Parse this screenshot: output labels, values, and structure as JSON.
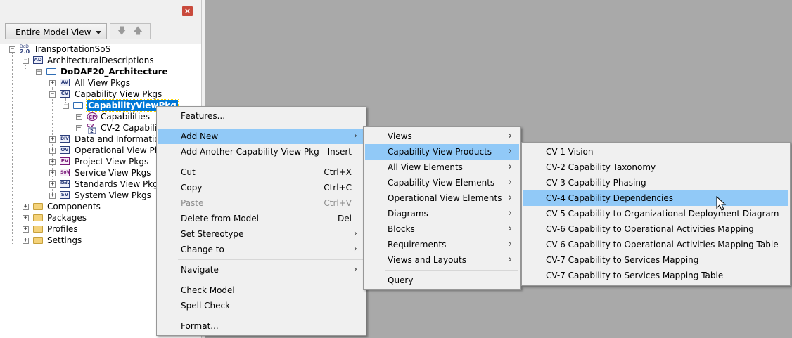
{
  "left_panel": {
    "close_label": "×",
    "view_selector": "Entire Model View",
    "nav_down_icon": "arrow-down-icon",
    "nav_up_icon": "arrow-up-icon"
  },
  "tree": {
    "root": "TransportationSoS",
    "root_badge": "DoD 2.0",
    "architectural_descriptions": "ArchitecturalDescriptions",
    "ad_badge": "AD",
    "architecture": "DoDAF20_Architecture",
    "all_view": "All View Pkgs",
    "capability_view": "Capability View Pkgs",
    "capability_view_pkg": "CapabilityViewPkg",
    "capabilities": "Capabilities",
    "cv2": "CV-2 Capabilit",
    "data_info": "Data and Information",
    "operational": "Operational View Pkgs",
    "project": "Project View Pkgs",
    "service": "Service View Pkgs",
    "standards": "Standards View Pkgs",
    "system": "System View Pkgs",
    "components": "Components",
    "packages": "Packages",
    "profiles": "Profiles",
    "settings": "Settings",
    "badges": {
      "av": "AV",
      "cv": "CV",
      "cp": "CP",
      "cv2": "CV 2",
      "div": "DIV",
      "ov": "OV",
      "pv": "PV",
      "sov": "SoV",
      "stdv": "StdV",
      "sv": "SV"
    }
  },
  "context_menu": {
    "features": "Features...",
    "add_new": "Add New",
    "add_another": "Add Another Capability View Pkg",
    "add_another_shortcut": "Insert",
    "cut": "Cut",
    "cut_shortcut": "Ctrl+X",
    "copy": "Copy",
    "copy_shortcut": "Ctrl+C",
    "paste": "Paste",
    "paste_shortcut": "Ctrl+V",
    "delete": "Delete from Model",
    "delete_shortcut": "Del",
    "set_stereotype": "Set Stereotype",
    "change_to": "Change to",
    "navigate": "Navigate",
    "check_model": "Check Model",
    "spell_check": "Spell Check",
    "format": "Format..."
  },
  "add_new_menu": {
    "views": "Views",
    "capability_view_products": "Capability View Products",
    "all_view_elements": "All View Elements",
    "capability_view_elements": "Capability View Elements",
    "operational_view_elements": "Operational View Elements",
    "diagrams": "Diagrams",
    "blocks": "Blocks",
    "requirements": "Requirements",
    "views_and_layouts": "Views and Layouts",
    "query": "Query"
  },
  "products_menu": {
    "items": [
      "CV-1 Vision",
      "CV-2 Capability Taxonomy",
      "CV-3 Capability Phasing",
      "CV-4 Capability Dependencies",
      "CV-5 Capability to Organizational Deployment Diagram",
      "CV-6 Capability to Operational Activities Mapping",
      "CV-6 Capability to Operational Activities Mapping Table",
      "CV-7 Capability to Services Mapping",
      "CV-7 Capability to Services Mapping Table"
    ]
  },
  "colors": {
    "highlight": "#91c9f7",
    "selection": "#0078d7"
  }
}
